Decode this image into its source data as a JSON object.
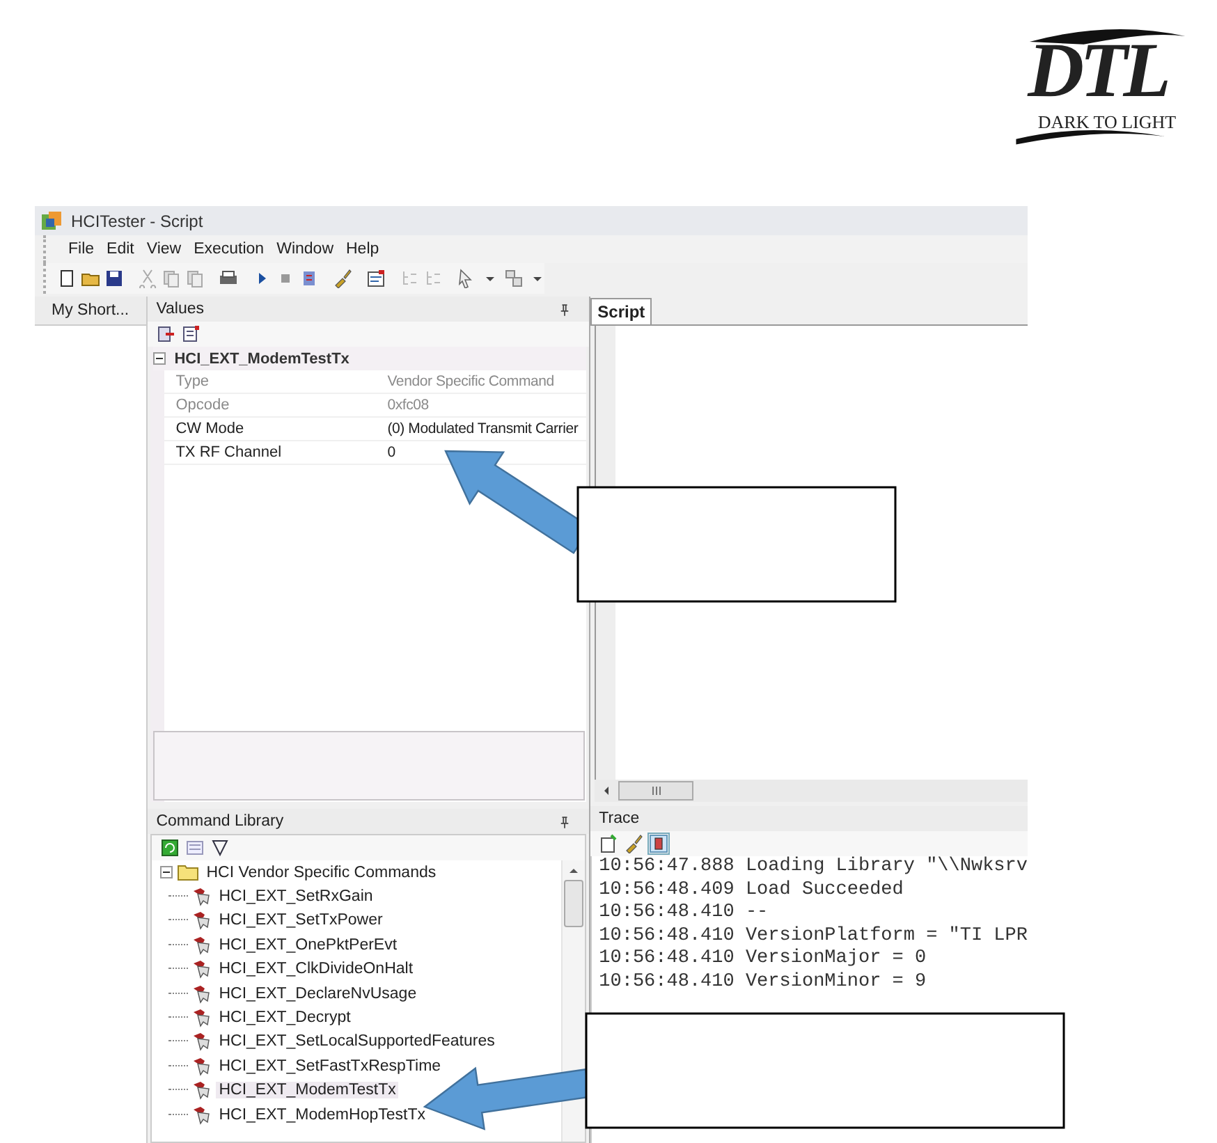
{
  "logo": {
    "letters": "DTL",
    "tagline": "DARK TO LIGHT"
  },
  "window": {
    "title": "HCITester - Script"
  },
  "menu": [
    {
      "label": "File"
    },
    {
      "label": "Edit"
    },
    {
      "label": "View"
    },
    {
      "label": "Execution"
    },
    {
      "label": "Window"
    },
    {
      "label": "Help"
    }
  ],
  "shortcuts_panel": {
    "tab": "My Short..."
  },
  "values_panel": {
    "title": "Values",
    "command": {
      "name": "HCI_EXT_ModemTestTx",
      "expanded": true
    },
    "properties": [
      {
        "name": "Type",
        "value": "Vendor Specific Command",
        "disabled": true
      },
      {
        "name": "Opcode",
        "value": "0xfc08",
        "disabled": true
      },
      {
        "name": "CW Mode",
        "value": "(0) Modulated Transmit Carrier",
        "disabled": false
      },
      {
        "name": "TX RF Channel",
        "value": "0",
        "disabled": false
      }
    ]
  },
  "script_panel": {
    "tabs": [
      {
        "label": "Script",
        "selected": true
      }
    ]
  },
  "command_library": {
    "title": "Command Library",
    "tree": [
      {
        "label": "HCI Vendor Specific Commands",
        "expanded": true,
        "children": [
          {
            "label": "HCI_EXT_SetRxGain",
            "selected": false
          },
          {
            "label": "HCI_EXT_SetTxPower",
            "selected": false
          },
          {
            "label": "HCI_EXT_OnePktPerEvt",
            "selected": false
          },
          {
            "label": "HCI_EXT_ClkDivideOnHalt",
            "selected": false
          },
          {
            "label": "HCI_EXT_DeclareNvUsage",
            "selected": false
          },
          {
            "label": "HCI_EXT_Decrypt",
            "selected": false
          },
          {
            "label": "HCI_EXT_SetLocalSupportedFeatures",
            "selected": false
          },
          {
            "label": "HCI_EXT_SetFastTxRespTime",
            "selected": false
          },
          {
            "label": "HCI_EXT_ModemTestTx",
            "selected": true
          },
          {
            "label": "HCI_EXT_ModemHopTestTx",
            "selected": false
          }
        ]
      }
    ]
  },
  "trace": {
    "title": "Trace",
    "lines": [
      {
        "time": "10:56:47.888",
        "message": "Loading Library \"\\\\Nwksrv"
      },
      {
        "time": "10:56:48.409",
        "message": "Load Succeeded"
      },
      {
        "time": "10:56:48.410",
        "message": "--"
      },
      {
        "time": "10:56:48.410",
        "message": "VersionPlatform = \"TI LPR"
      },
      {
        "time": "10:56:48.410",
        "message": "VersionMajor = 0"
      },
      {
        "time": "10:56:48.410",
        "message": "VersionMinor = 9"
      }
    ]
  }
}
